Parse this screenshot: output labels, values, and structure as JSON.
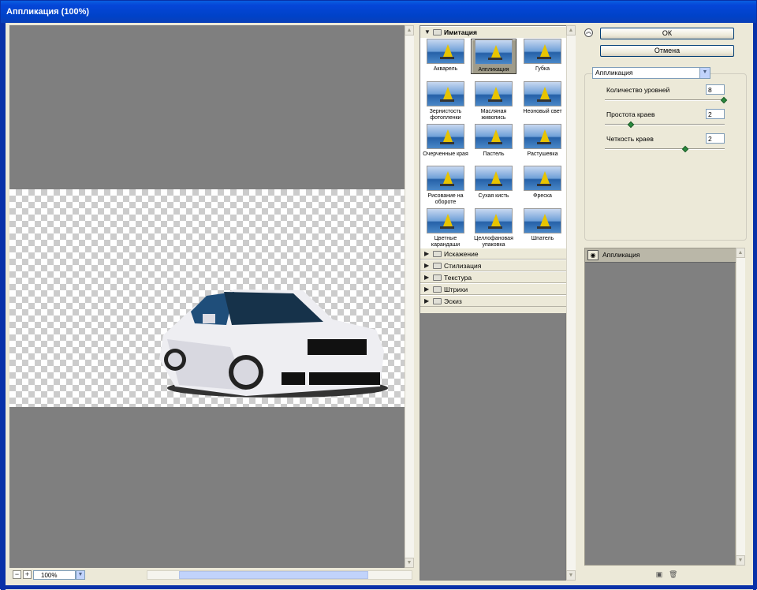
{
  "window": {
    "title": "Аппликация (100%)"
  },
  "preview": {
    "zoom": "100%"
  },
  "gallery": {
    "open_category": "Имитация",
    "thumbnails": [
      {
        "label": "Акварель"
      },
      {
        "label": "Аппликация",
        "selected": true
      },
      {
        "label": "Губка"
      },
      {
        "label": "Зернистость фотопленки"
      },
      {
        "label": "Масляная живопись"
      },
      {
        "label": "Неоновый свет"
      },
      {
        "label": "Очерченные края"
      },
      {
        "label": "Пастель"
      },
      {
        "label": "Растушевка"
      },
      {
        "label": "Рисование на обороте"
      },
      {
        "label": "Сухая кисть"
      },
      {
        "label": "Фреска"
      },
      {
        "label": "Цветные карандаши"
      },
      {
        "label": "Целлофановая упаковка"
      },
      {
        "label": "Шпатель"
      }
    ],
    "categories": [
      "Искажение",
      "Стилизация",
      "Текстура",
      "Штрихи",
      "Эскиз"
    ]
  },
  "panel": {
    "ok_label": "ОК",
    "cancel_label": "Отмена",
    "filter_select": "Аппликация",
    "params": [
      {
        "label": "Количество уровней",
        "value": "8",
        "slider_fraction": 1.0
      },
      {
        "label": "Простота краев",
        "value": "2",
        "slider_fraction": 0.2
      },
      {
        "label": "Четкость краев",
        "value": "2",
        "slider_fraction": 0.67
      }
    ],
    "layer_name": "Аппликация"
  },
  "icons": {
    "eye": "eye-icon",
    "new_layer": "new-layer-icon",
    "delete_layer": "trash-icon",
    "collapse": "chevron-up-icon"
  },
  "colors": {
    "title_bar": "#0054e3",
    "selection": "#a09c8a",
    "slider_knob": "#2b8a3e"
  }
}
